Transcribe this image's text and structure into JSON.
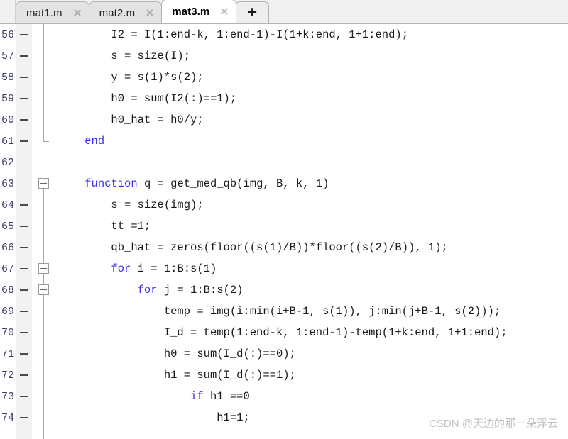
{
  "window": {
    "app_kind": "code-editor",
    "accent_keyword_color": "#3b2ff0",
    "gutter_number_color": "#3a3a6a",
    "active_tab_bg": "#ffffff",
    "inactive_tab_bg": "#e3e3e3"
  },
  "tabbar": {
    "tabs": [
      {
        "label": "mat1.m",
        "active": false,
        "close_icon": "close-icon"
      },
      {
        "label": "mat2.m",
        "active": false,
        "close_icon": "close-icon"
      },
      {
        "label": "mat3.m",
        "active": true,
        "close_icon": "close-icon"
      }
    ],
    "add_tab_label": "+"
  },
  "editor": {
    "first_line": 56,
    "lines": [
      {
        "num": "56",
        "dash": true,
        "indent": 8,
        "text": "I2 = I(1:end-k, 1:end-1)-I(1+k:end, 1+1:end);",
        "keyword": ""
      },
      {
        "num": "57",
        "dash": true,
        "indent": 8,
        "text": "s = size(I);",
        "keyword": ""
      },
      {
        "num": "58",
        "dash": true,
        "indent": 8,
        "text": "y = s(1)*s(2);",
        "keyword": ""
      },
      {
        "num": "59",
        "dash": true,
        "indent": 8,
        "text": "h0 = sum(I2(:)==1);",
        "keyword": ""
      },
      {
        "num": "60",
        "dash": true,
        "indent": 8,
        "text": "h0_hat = h0/y;",
        "keyword": ""
      },
      {
        "num": "61",
        "dash": true,
        "indent": 4,
        "text": "end",
        "keyword": "end"
      },
      {
        "num": "62",
        "dash": false,
        "indent": 0,
        "text": "",
        "keyword": ""
      },
      {
        "num": "63",
        "dash": false,
        "indent": 4,
        "text": "function q = get_med_qb(img, B, k, 1)",
        "keyword": "function"
      },
      {
        "num": "64",
        "dash": true,
        "indent": 8,
        "text": "s = size(img);",
        "keyword": ""
      },
      {
        "num": "65",
        "dash": true,
        "indent": 8,
        "text": "tt =1;",
        "keyword": ""
      },
      {
        "num": "66",
        "dash": true,
        "indent": 8,
        "text": "qb_hat = zeros(floor((s(1)/B))*floor((s(2)/B)), 1);",
        "keyword": ""
      },
      {
        "num": "67",
        "dash": true,
        "indent": 8,
        "text": "for i = 1:B:s(1)",
        "keyword": "for"
      },
      {
        "num": "68",
        "dash": true,
        "indent": 12,
        "text": "for j = 1:B:s(2)",
        "keyword": "for"
      },
      {
        "num": "69",
        "dash": true,
        "indent": 16,
        "text": "temp = img(i:min(i+B-1, s(1)), j:min(j+B-1, s(2)));",
        "keyword": ""
      },
      {
        "num": "70",
        "dash": true,
        "indent": 16,
        "text": "I_d = temp(1:end-k, 1:end-1)-temp(1+k:end, 1+1:end);",
        "keyword": ""
      },
      {
        "num": "71",
        "dash": true,
        "indent": 16,
        "text": "h0 = sum(I_d(:)==0);",
        "keyword": ""
      },
      {
        "num": "72",
        "dash": true,
        "indent": 16,
        "text": "h1 = sum(I_d(:)==1);",
        "keyword": ""
      },
      {
        "num": "73",
        "dash": true,
        "indent": 20,
        "text": "if h1 ==0",
        "keyword": "if"
      },
      {
        "num": "74",
        "dash": true,
        "indent": 24,
        "text": "h1=1;",
        "keyword": ""
      }
    ],
    "fold_markers": [
      {
        "line_index": 7,
        "type": "collapse-box"
      },
      {
        "line_index": 11,
        "type": "collapse-box"
      },
      {
        "line_index": 12,
        "type": "collapse-box"
      }
    ]
  },
  "watermark": {
    "text": "CSDN @天边的那一朵浮云"
  }
}
